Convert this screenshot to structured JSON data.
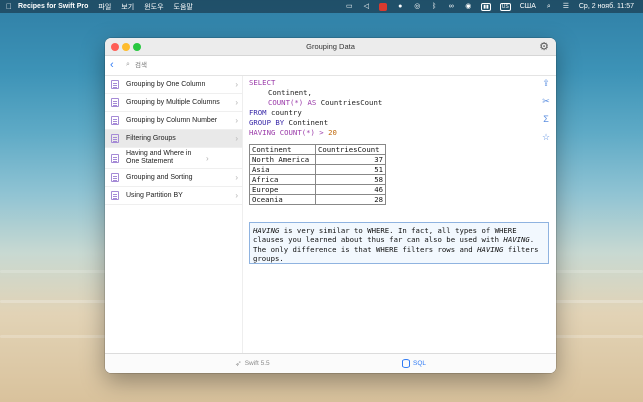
{
  "menubar": {
    "app_name": "Recipes for Swift Pro",
    "menus": [
      "파일",
      "보기",
      "윈도우",
      "도움말"
    ],
    "input_source": "США",
    "clock": "Ср, 2 нояб.  11:57"
  },
  "window": {
    "title": "Grouping Data",
    "search_placeholder": "검색"
  },
  "sidebar": {
    "items": [
      {
        "label": "Grouping by One Column"
      },
      {
        "label": "Grouping by Multiple Columns"
      },
      {
        "label": "Grouping by Column Number"
      },
      {
        "label": "Filtering Groups"
      },
      {
        "label": "Having and Where in One Statement"
      },
      {
        "label": "Grouping and Sorting"
      },
      {
        "label": "Using Partition BY"
      }
    ],
    "selected_index": 3
  },
  "sql": {
    "line1": "SELECT",
    "line2": "Continent,",
    "line3_a": "COUNT(*) AS",
    "line3_b": " CountriesCount",
    "line4_a": "FROM",
    "line4_b": " country",
    "line5_a": "GROUP BY",
    "line5_b": " Continent",
    "line6_a": "HAVING COUNT(*) >",
    "line6_b": " 20"
  },
  "result": {
    "headers": [
      "Continent",
      "CountriesCount"
    ],
    "rows": [
      [
        "North America",
        "37"
      ],
      [
        "Asia",
        "51"
      ],
      [
        "Africa",
        "58"
      ],
      [
        "Europe",
        "46"
      ],
      [
        "Oceania",
        "28"
      ]
    ]
  },
  "note": {
    "p1": "HAVING",
    "p2": " is very similar to WHERE. In fact, all types of WHERE clauses you learned about thus far can also be used with ",
    "p3": "HAVING",
    "p4": ". The only difference is that WHERE filters rows and ",
    "p5": "HAVING",
    "p6": " filters groups."
  },
  "bottombar": {
    "swift_label": "Swift 5.5",
    "sql_label": "SQL"
  },
  "icons": [
    "apple-icon",
    "gear-icon",
    "back-arrow-icon",
    "search-icon",
    "share-icon",
    "scissors-icon",
    "sigma-icon",
    "star-icon",
    "swift-icon",
    "database-icon"
  ],
  "colors": {
    "accent": "#2f7bf5",
    "sql_keyword": "#9a3aa9",
    "sql_number": "#c06a0d",
    "note_border": "#8fb3e0"
  }
}
